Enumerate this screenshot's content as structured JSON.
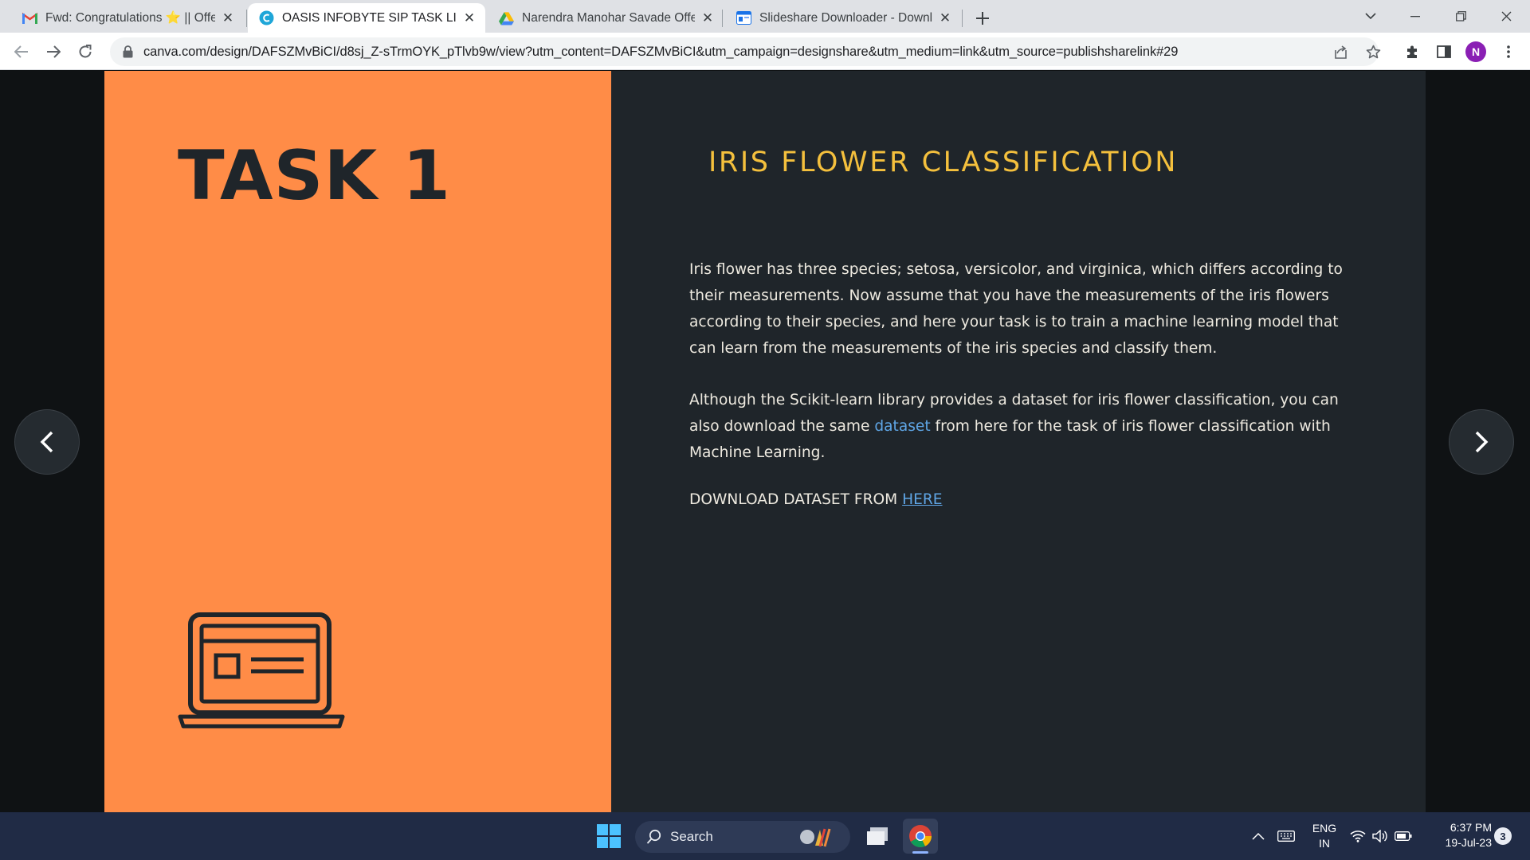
{
  "browser": {
    "tabs": [
      {
        "title": "Fwd: Congratulations ⭐ || Offer L",
        "icon": "gmail-icon",
        "active": false
      },
      {
        "title": "OASIS INFOBYTE SIP TASK LIST",
        "icon": "canva-icon",
        "active": true
      },
      {
        "title": "Narendra Manohar Savade Offer",
        "icon": "google-drive-icon",
        "active": false
      },
      {
        "title": "Slideshare Downloader - Downlo",
        "icon": "slideshare-icon",
        "active": false
      }
    ],
    "url": "canva.com/design/DAFSZMvBiCI/d8sj_Z-sTrmOYK_pTlvb9w/view?utm_content=DAFSZMvBiCI&utm_campaign=designshare&utm_medium=link&utm_source=publishsharelink#29",
    "profile_initial": "N"
  },
  "slide": {
    "task_title": "TASK 1",
    "heading": "IRIS FLOWER CLASSIFICATION",
    "paragraph1": "Iris flower has three species; setosa, versicolor, and virginica, which differs according to their measurements. Now assume that you have the measurements of the iris flowers according to their species, and here your task is to train a machine learning model that can learn from the measurements of the iris species and classify them.",
    "paragraph2_before": "Although the Scikit-learn library provides a dataset for iris flower classification, you can also download the same ",
    "paragraph2_link": "dataset",
    "paragraph2_after": " from here for the task of iris flower classification with Machine Learning.",
    "download_prefix": "DOWNLOAD DATASET FROM ",
    "download_link": "HERE",
    "colors": {
      "left_panel": "#ff8c47",
      "right_panel": "#1f252a",
      "heading": "#f4c03d",
      "link": "#5fa6e6"
    }
  },
  "taskbar": {
    "search_label": "Search",
    "language_line1": "ENG",
    "language_line2": "IN",
    "time": "6:37 PM",
    "date": "19-Jul-23",
    "notification_count": "3"
  }
}
